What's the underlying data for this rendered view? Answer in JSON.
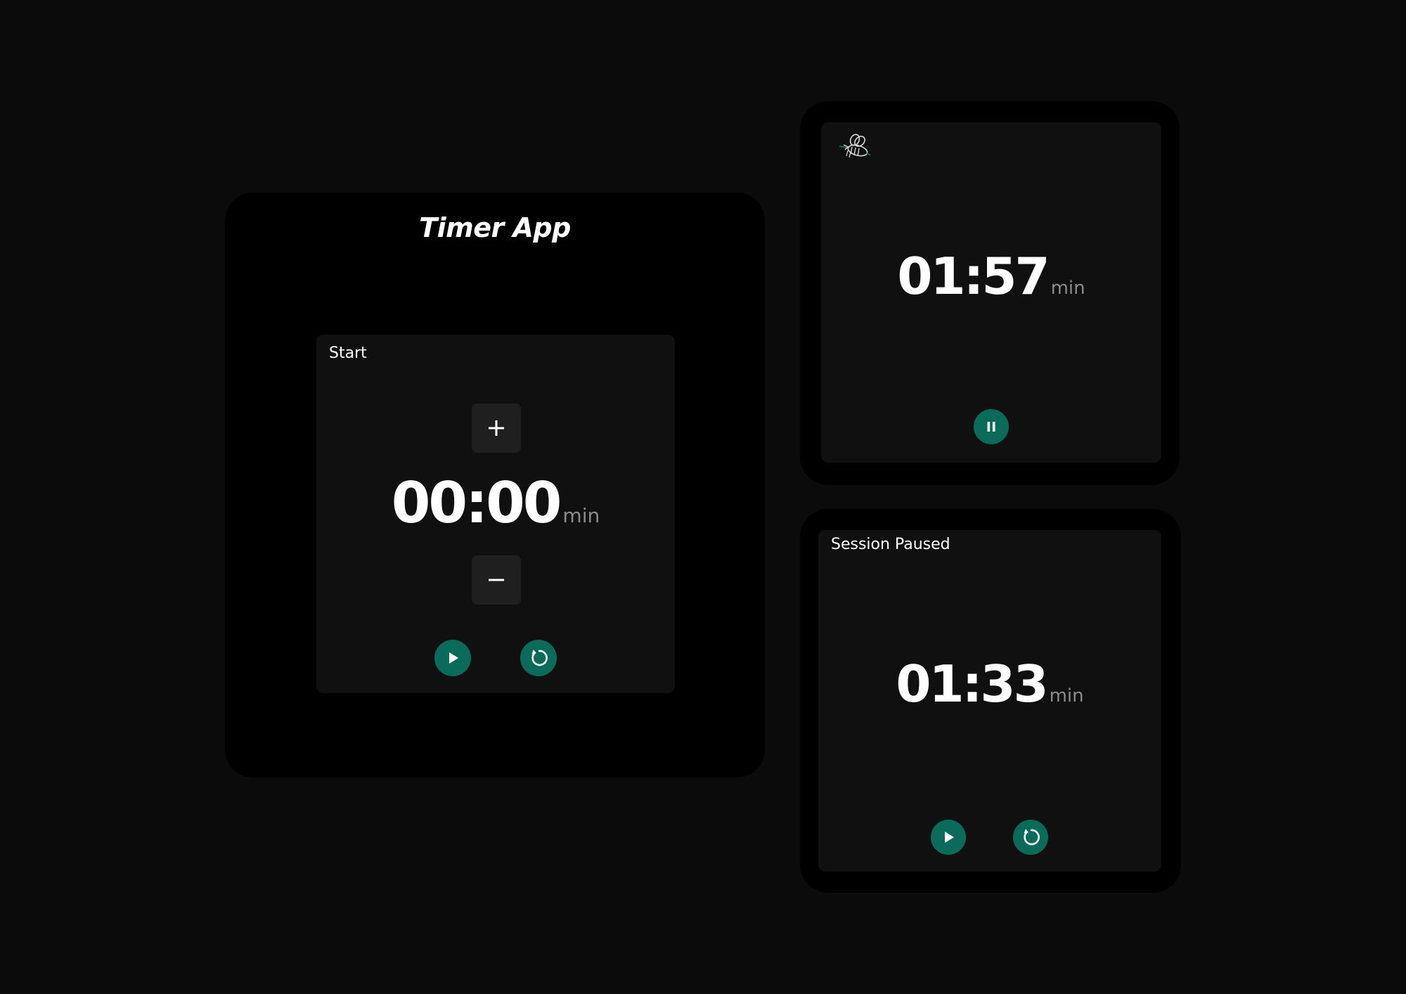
{
  "app": {
    "title": "Timer App"
  },
  "setup_timer": {
    "label": "Start",
    "time": "00:00",
    "unit": "min",
    "increment_icon": "plus-icon",
    "decrement_icon": "minus-icon",
    "controls": [
      "play-icon",
      "reset-icon"
    ]
  },
  "running_timer": {
    "icon": "bee-icon",
    "time": "01:57",
    "unit": "min",
    "controls": [
      "pause-icon"
    ]
  },
  "paused_timer": {
    "label": "Session Paused",
    "time": "01:33",
    "unit": "min",
    "controls": [
      "play-icon",
      "reset-icon"
    ]
  },
  "colors": {
    "background": "#0b0b0b",
    "card": "#000000",
    "panel": "#101010",
    "step_button": "#1f1f1f",
    "accent": "#0b6b5b",
    "unit_text": "#8b8b8b"
  }
}
